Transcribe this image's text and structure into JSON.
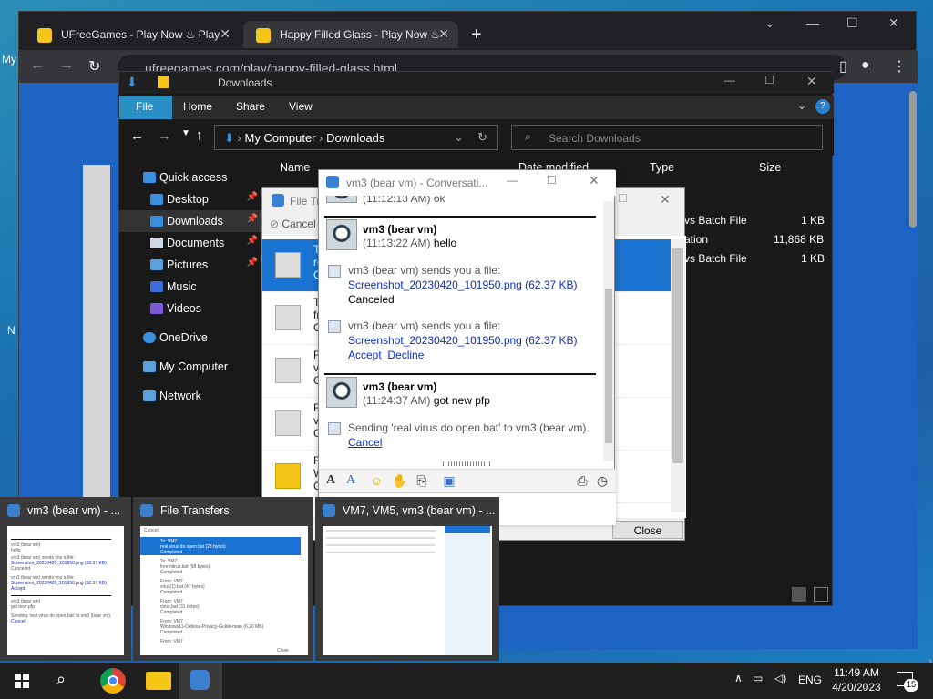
{
  "browser": {
    "tabs": [
      {
        "title": "UFreeGames - Play Now ♨ Play"
      },
      {
        "title": "Happy Filled Glass - Play Now ♨"
      }
    ],
    "url": "ufreegames.com/play/happy-filled-glass.html"
  },
  "desktop_edge_labels": {
    "top": "My",
    "mid": "N"
  },
  "explorer": {
    "title": "Downloads",
    "ribbon_tabs": [
      "File",
      "Home",
      "Share",
      "View"
    ],
    "breadcrumb": [
      "My Computer",
      "Downloads"
    ],
    "search_placeholder": "Search Downloads",
    "nav": [
      {
        "label": "Quick access",
        "pinned": false
      },
      {
        "label": "Desktop",
        "pinned": true
      },
      {
        "label": "Downloads",
        "pinned": true,
        "selected": true
      },
      {
        "label": "Documents",
        "pinned": true
      },
      {
        "label": "Pictures",
        "pinned": true
      },
      {
        "label": "Music",
        "pinned": false
      },
      {
        "label": "Videos",
        "pinned": false
      },
      {
        "label": "OneDrive",
        "pinned": false
      },
      {
        "label": "My Computer",
        "pinned": false
      },
      {
        "label": "Network",
        "pinned": false
      }
    ],
    "columns": {
      "name": "Name",
      "date": "Date modified",
      "type": "Type",
      "size": "Size"
    },
    "files": [
      {
        "type": "vs Batch File",
        "size": "1 KB"
      },
      {
        "type": "ation",
        "size": "11,868 KB"
      },
      {
        "type": "vs Batch File",
        "size": "1 KB"
      }
    ]
  },
  "file_transfers": {
    "title": "File Tr",
    "cancel_label": "Cancel",
    "close_label": "Close",
    "rows": [
      {
        "line1": "To",
        "line2": "re",
        "line3": "C"
      },
      {
        "line1": "To",
        "line2": "fr",
        "line3": "C"
      },
      {
        "line1": "Fr",
        "line2": "vi",
        "line3": "C"
      },
      {
        "line1": "Fr",
        "line2": "vi",
        "line3": "C"
      },
      {
        "line1": "Fr",
        "line2": "W",
        "line3": "C"
      }
    ]
  },
  "conversation": {
    "title": "vm3 (bear vm) - Conversati...",
    "top_partial": "(11:12:13 AM) ok",
    "messages": [
      {
        "sender": "vm3 (bear vm)",
        "time": "(11:13:22 AM)",
        "text": "hello"
      },
      {
        "sender": "vm3 (bear vm)",
        "time": "(11:24:37 AM)",
        "text": "got new pfp"
      }
    ],
    "file1": {
      "notice": "vm3 (bear vm) sends you a file:",
      "file": "Screenshot_20230420_101950.png (62.37 KB)",
      "status": "Canceled"
    },
    "file2": {
      "notice": "vm3 (bear vm) sends you a file:",
      "file": "Screenshot_20230420_101950.png (62.37 KB)",
      "accept": "Accept",
      "decline": "Decline"
    },
    "sending": {
      "notice": "Sending 'real virus do open.bat' to vm3 (bear vm).",
      "cancel": "Cancel"
    }
  },
  "thumbnails": [
    {
      "title": "vm3 (bear vm) - ..."
    },
    {
      "title": "File Transfers"
    },
    {
      "title": "VM7, VM5, vm3 (bear vm) - ..."
    }
  ],
  "thumb2_mini": [
    "To: VM7",
    "real virus do open.bat (28 bytes)",
    "Completed",
    "To: VM7",
    "free nitrus.bat (68 bytes)",
    "Completed",
    "From: VM7",
    "virus(1).bat (47 bytes)",
    "Completed",
    "From: VM7",
    "virus.bat (31 bytes)",
    "Completed",
    "From: VM7",
    "Windows11-Debloat-Privacy-Guide-main (6.20 MB)",
    "Completed",
    "From: VM7"
  ],
  "taskbar": {
    "language": "ENG",
    "time": "11:49 AM",
    "date": "4/20/2023",
    "notifications": "15"
  },
  "colors": {
    "accent": "#2a8fc4",
    "link": "#0b2fc2",
    "taskbar": "#1f1f1f"
  }
}
